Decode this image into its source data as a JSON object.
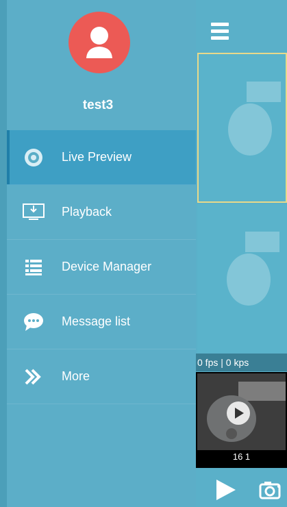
{
  "sidebar": {
    "username": "test3",
    "items": [
      {
        "label": "Live Preview",
        "icon": "live-preview-icon"
      },
      {
        "label": "Playback",
        "icon": "playback-icon"
      },
      {
        "label": "Device Manager",
        "icon": "device-manager-icon"
      },
      {
        "label": "Message list",
        "icon": "message-list-icon"
      },
      {
        "label": "More",
        "icon": "more-icon"
      }
    ]
  },
  "main": {
    "stats": "0 fps | 0 kps",
    "thumbnail_label": "16 1"
  },
  "colors": {
    "accent": "#3e9fc4",
    "avatar_bg": "#ec5a55",
    "sidebar_bg": "#5caec8",
    "selected_border": "#e8d98a"
  }
}
